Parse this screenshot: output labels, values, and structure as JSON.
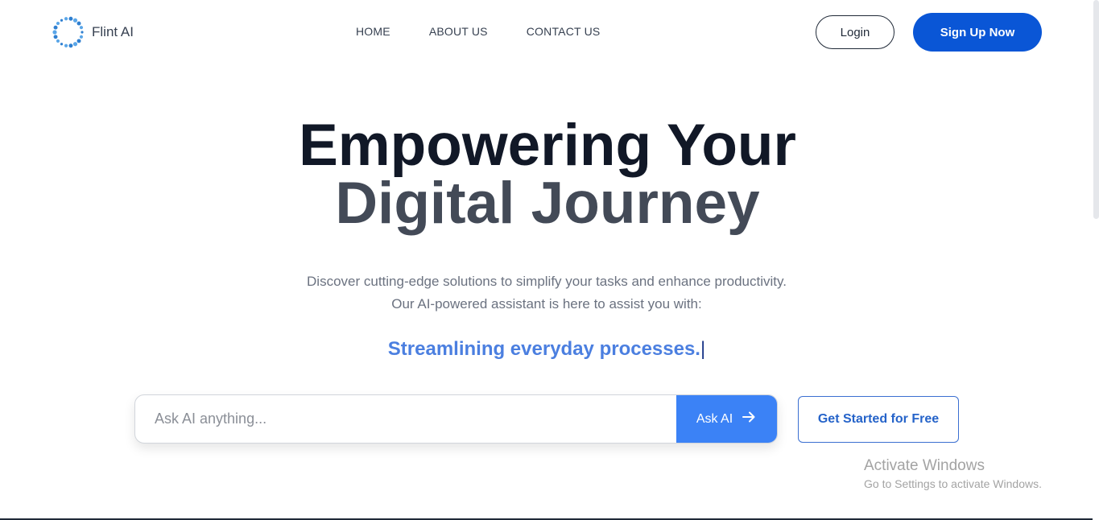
{
  "header": {
    "brand": "Flint AI",
    "logo_icon": "dotted-ring-logo-icon",
    "nav": [
      "HOME",
      "ABOUT US",
      "CONTACT US"
    ],
    "login_label": "Login",
    "signup_label": "Sign Up Now"
  },
  "hero": {
    "title_line1": "Empowering Your",
    "title_line2": "Digital Journey",
    "subtitle_line1": "Discover cutting-edge solutions to simplify your tasks and enhance productivity.",
    "subtitle_line2": "Our AI-powered assistant is here to assist you with:",
    "typed_text": "Streamlining everyday processes.",
    "typed_cursor": "|"
  },
  "search": {
    "placeholder": "Ask AI anything...",
    "value": "",
    "ask_label": "Ask AI",
    "ask_icon": "arrow-right-icon"
  },
  "cta": {
    "get_started_label": "Get Started for Free"
  },
  "watermark": {
    "title": "Activate Windows",
    "subtitle": "Go to Settings to activate Windows."
  },
  "colors": {
    "primary": "#0a56d6",
    "accent": "#3b82f6",
    "typed_text": "#4b7fe0",
    "title_dark": "#111827",
    "title_gray": "#434a57"
  }
}
